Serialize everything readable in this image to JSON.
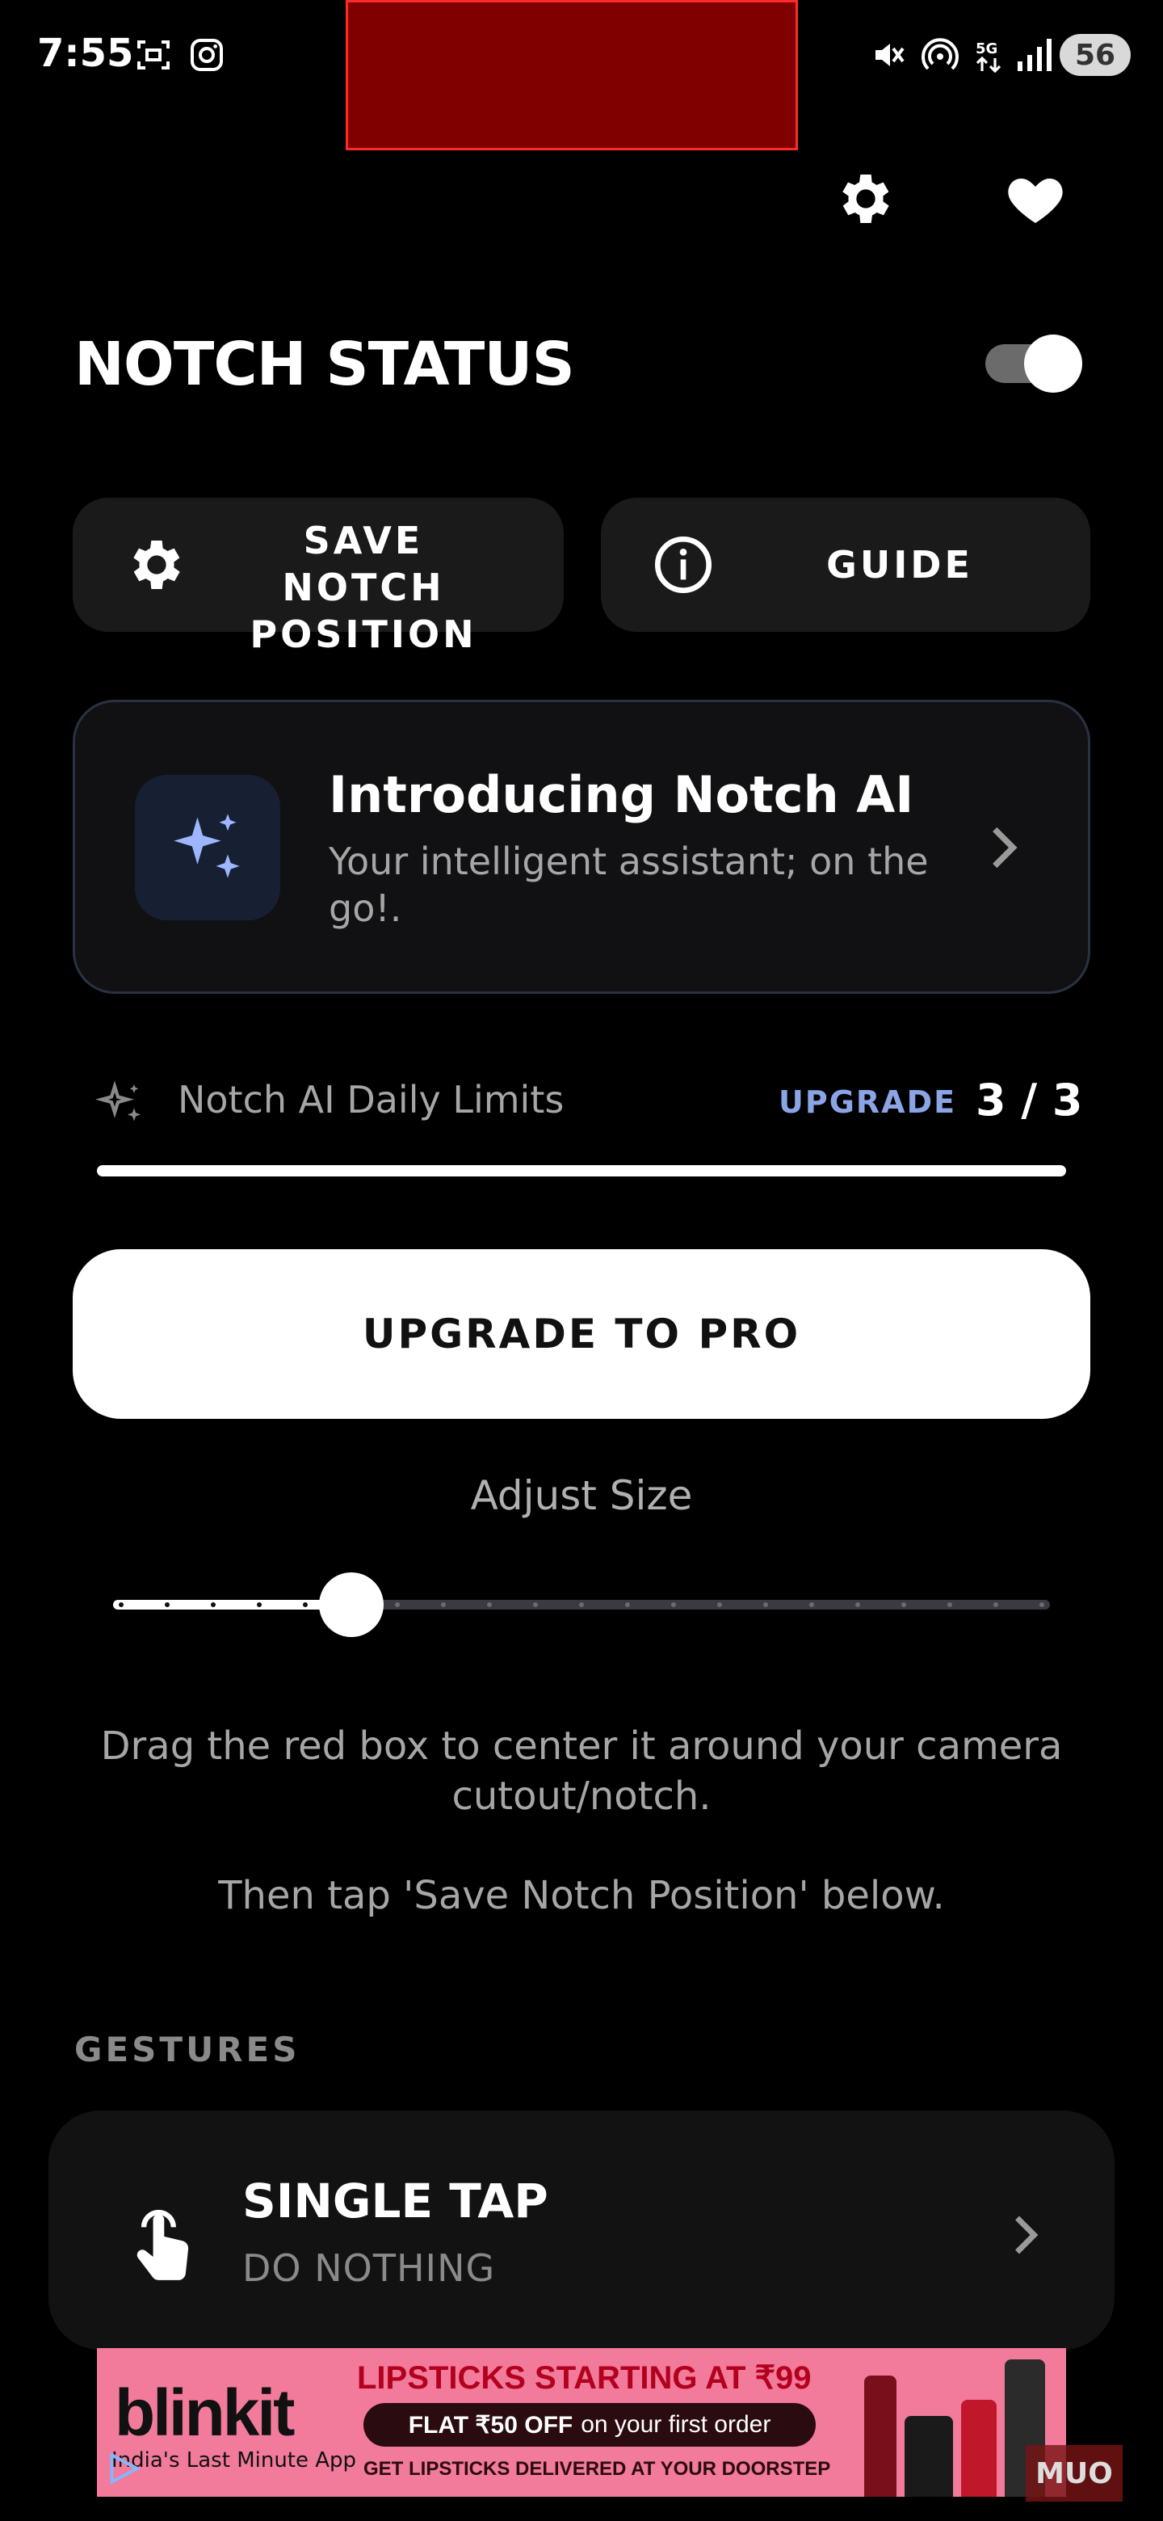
{
  "status_bar": {
    "time": "7:55",
    "battery": "56"
  },
  "main": {
    "notch_status_title": "NOTCH STATUS",
    "toggle_on": true,
    "save_button_label": "SAVE NOTCH POSITION",
    "guide_button_label": "GUIDE",
    "ai_card": {
      "title": "Introducing Notch AI",
      "subtitle": "Your intelligent assistant; on the go!."
    },
    "limits": {
      "label": "Notch AI Daily Limits",
      "upgrade_link": "UPGRADE",
      "count": "3 / 3",
      "fraction_used": 1.0
    },
    "upgrade_button_label": "UPGRADE TO PRO",
    "adjust_size_label": "Adjust Size",
    "slider": {
      "value_step": 5,
      "total_steps": 21
    },
    "instruction_1": "Drag the red box to center it around your camera cutout/notch.",
    "instruction_2": "Then tap 'Save Notch Position' below."
  },
  "gestures": {
    "section_title": "GESTURES",
    "single_tap": {
      "title": "SINGLE TAP",
      "value": "DO NOTHING"
    }
  },
  "ad": {
    "brand": "blinkit",
    "tagline": "India's Last Minute App",
    "headline": "LIPSTICKS STARTING AT ₹99",
    "offer_bold": "FLAT ₹50 OFF",
    "offer_rest": "on your first order",
    "footer": "GET LIPSTICKS DELIVERED AT YOUR DOORSTEP"
  },
  "watermark": "MUO",
  "colors": {
    "background": "#000000",
    "card": "#1a1a1a",
    "accent_link": "#8aa4e6",
    "notch_box": "#800000"
  }
}
